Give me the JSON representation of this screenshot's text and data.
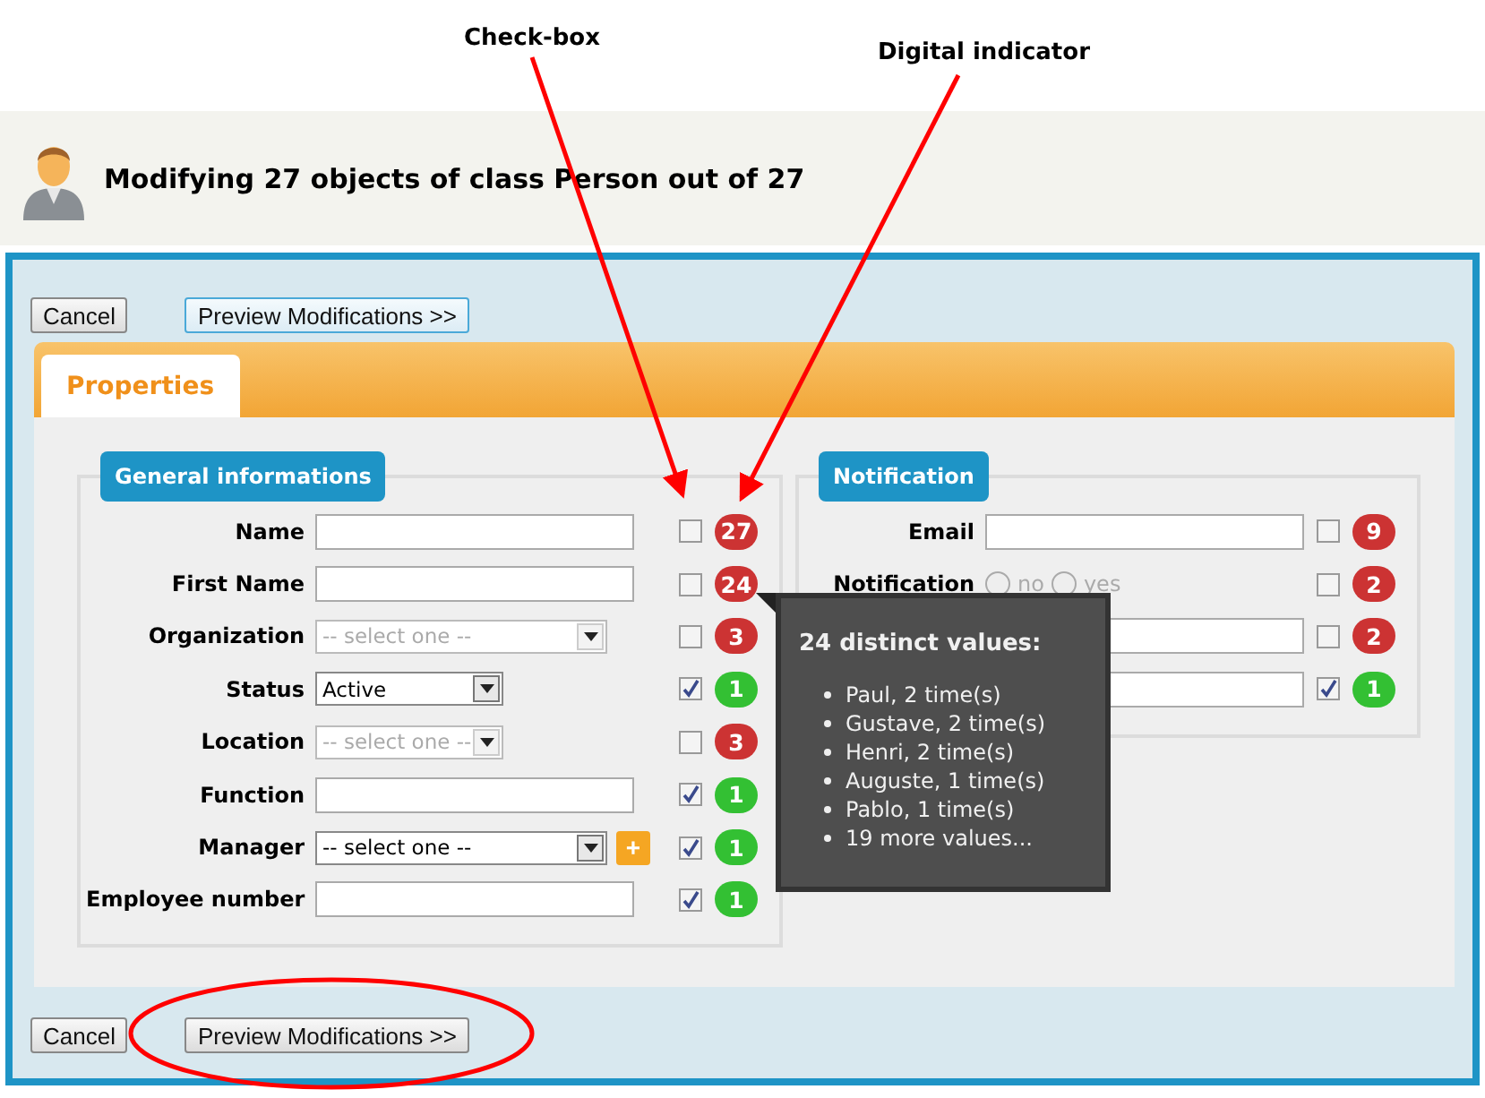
{
  "annotations": [
    {
      "text": "Check-box"
    },
    {
      "text": "Digital indicator"
    }
  ],
  "header": {
    "title": "Modifying 27 objects of class Person out of 27"
  },
  "top_buttons": [
    {
      "label": "Cancel",
      "kind": "plain"
    },
    {
      "label": "Preview Modifications >>",
      "kind": "primary"
    }
  ],
  "tabs": [
    {
      "label": "Properties",
      "selected": true
    }
  ],
  "groups": [
    {
      "title": "General informations",
      "fields": [
        {
          "label": "Name",
          "kind": "text",
          "checked": false,
          "count": "27",
          "color": "#cc3333"
        },
        {
          "label": "First Name",
          "kind": "text",
          "checked": false,
          "count": "24",
          "color": "#cc3333"
        },
        {
          "label": "Organization",
          "kind": "select",
          "placeholder": "-- select one --",
          "disabled": true,
          "checked": false,
          "count": "3",
          "color": "#cc3333"
        },
        {
          "label": "Status",
          "kind": "short_select",
          "value": "Active",
          "disabled": false,
          "checked": true,
          "count": "1",
          "color": "#33c033"
        },
        {
          "label": "Location",
          "kind": "short_select",
          "placeholder": "-- select one --",
          "disabled": true,
          "checked": false,
          "count": "3",
          "color": "#cc3333"
        },
        {
          "label": "Function",
          "kind": "text",
          "checked": true,
          "count": "1",
          "color": "#33c033"
        },
        {
          "label": "Manager",
          "kind": "select",
          "value": "-- select one --",
          "disabled": false,
          "add_button": "+",
          "checked": true,
          "count": "1",
          "color": "#33c033"
        },
        {
          "label": "Employee number",
          "kind": "text",
          "checked": true,
          "count": "1",
          "color": "#33c033"
        }
      ]
    },
    {
      "title": "Notification",
      "fields": [
        {
          "label": "Email",
          "kind": "text",
          "checked": false,
          "count": "9",
          "color": "#cc3333"
        },
        {
          "label": "Notification",
          "kind": "radio",
          "options": [
            {
              "label": "no",
              "selected": false
            },
            {
              "label": "yes",
              "selected": false
            }
          ],
          "checked": false,
          "count": "2",
          "color": "#cc3333"
        },
        {
          "kind": "text",
          "checked": false,
          "count": "2",
          "color": "#cc3333"
        },
        {
          "kind": "text",
          "checked": true,
          "count": "1",
          "color": "#33c033"
        }
      ]
    }
  ],
  "tooltip": {
    "title": "24 distinct values:",
    "items": [
      "Paul, 2 time(s)",
      "Gustave, 2 time(s)",
      "Henri, 2 time(s)",
      "Auguste, 1 time(s)",
      "Pablo, 1 time(s)",
      "19 more values..."
    ]
  },
  "bottom_buttons": [
    {
      "label": "Cancel",
      "highlighted": false
    },
    {
      "label": "Preview Modifications >>",
      "highlighted": true
    }
  ]
}
